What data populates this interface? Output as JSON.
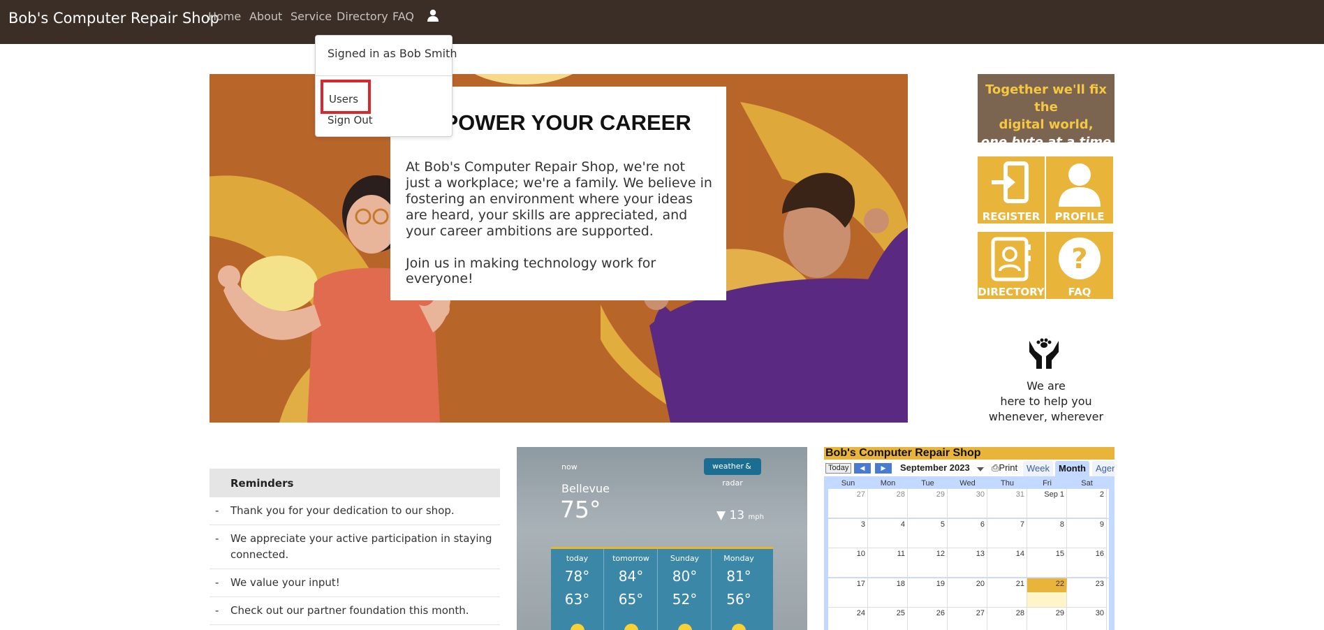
{
  "navbar": {
    "brand": "Bob's Computer Repair Shop",
    "items": [
      "Home",
      "About",
      "Service",
      "Directory",
      "FAQ"
    ]
  },
  "user_menu": {
    "signed_in": "Signed in as Bob Smith",
    "users": "Users",
    "sign_out": "Sign Out"
  },
  "hero": {
    "title": "EMPOWER YOUR CAREER",
    "paragraph1": "At Bob's Computer Repair Shop, we're not just a workplace; we're a family. We believe in fostering an environment where your ideas are heard, your skills are appreciated, and your career ambitions are supported.",
    "paragraph2": "Join us in making technology work for everyone!"
  },
  "sidebar": {
    "motto_line1": "Together we'll fix the",
    "motto_line2": "digital world,",
    "motto_line3": "one byte at a time",
    "tiles": [
      "REGISTER",
      "PROFILE",
      "DIRECTORY",
      "FAQ"
    ],
    "help_line1": "We are",
    "help_line2": "here to help you",
    "help_line3": "whenever, wherever"
  },
  "reminders": {
    "heading": "Reminders",
    "items": [
      "Thank you for your dedication to our shop.",
      "We appreciate your active participation in staying connected.",
      "We value your input!",
      "Check out our partner foundation this month."
    ]
  },
  "weather": {
    "now_label": "now",
    "badge": "weather & radar",
    "city": "Bellevue",
    "temp": "75°",
    "wind": "13",
    "wind_unit": "mph",
    "forecast": [
      {
        "day": "today",
        "hi": "78°",
        "lo": "63°"
      },
      {
        "day": "tomorrow",
        "hi": "84°",
        "lo": "65°"
      },
      {
        "day": "Sunday",
        "hi": "80°",
        "lo": "52°"
      },
      {
        "day": "Monday",
        "hi": "81°",
        "lo": "56°"
      }
    ]
  },
  "calendar": {
    "title": "Bob's Computer Repair Shop",
    "today_btn": "Today",
    "month": "September 2023",
    "print": "Print",
    "tabs": [
      "Week",
      "Month",
      "Agen"
    ],
    "dow": [
      "Sun",
      "Mon",
      "Tue",
      "Wed",
      "Thu",
      "Fri",
      "Sat"
    ],
    "weeks": [
      [
        "27",
        "28",
        "29",
        "30",
        "31",
        "Sep 1",
        "2"
      ],
      [
        "3",
        "4",
        "5",
        "6",
        "7",
        "8",
        "9"
      ],
      [
        "10",
        "11",
        "12",
        "13",
        "14",
        "15",
        "16"
      ],
      [
        "17",
        "18",
        "19",
        "20",
        "21",
        "22",
        "23"
      ],
      [
        "24",
        "25",
        "26",
        "27",
        "28",
        "29",
        "30"
      ]
    ],
    "accent": "#e9b43a"
  },
  "colors": {
    "navbar": "#3a2e27",
    "hero_bg": "#b8652a",
    "highlight_border": "#d9262f",
    "tile_bg": "#e9b43a"
  }
}
